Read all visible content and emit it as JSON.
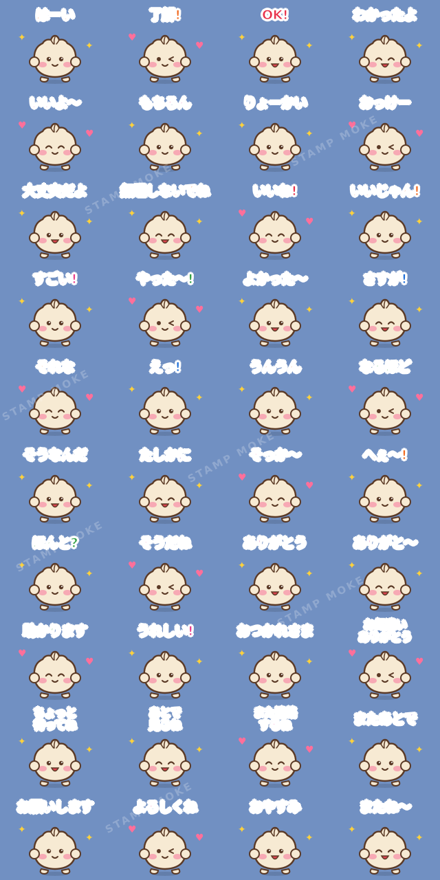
{
  "watermark_text": "STAMP MOKE",
  "colors": {
    "background": "#7190c2",
    "bun": "#f7ead3",
    "outline": "#5b3a26",
    "cheek": "#f7a9b4",
    "orange": "#f26b21",
    "red": "#e8304a",
    "pink": "#e83e8c",
    "blue": "#1f6fd8",
    "green": "#2e9e3f",
    "purple": "#7a3fc6",
    "star": "#ffd23c",
    "heart": "#ff6f9a"
  },
  "stickers": [
    {
      "label": "はーい",
      "color": "#f26b21"
    },
    {
      "label": "了解!",
      "color": "#f26b21"
    },
    {
      "label": "OK!",
      "color": "#e8304a"
    },
    {
      "label": "わかったよ",
      "color": "#2e9e3f"
    },
    {
      "label": "いいよ〜",
      "color": "#e83e8c"
    },
    {
      "label": "もちろん",
      "color": "#e83e8c"
    },
    {
      "label": "りょーかい",
      "color": "#1f6fd8"
    },
    {
      "label": "おっけー",
      "color": "#7a3fc6"
    },
    {
      "label": "大丈夫だよ",
      "color": "#2e9e3f"
    },
    {
      "label": "無理しないでね",
      "color": "#f26b21"
    },
    {
      "label": "いいね!",
      "color": "#e8304a"
    },
    {
      "label": "いいじゃん!",
      "color": "#f26b21"
    },
    {
      "label": "すごい!",
      "color": "#e83e8c"
    },
    {
      "label": "やった〜!",
      "color": "#2e9e3f"
    },
    {
      "label": "よかった〜",
      "color": "#e83e8c"
    },
    {
      "label": "さすが!",
      "color": "#1f6fd8"
    },
    {
      "label": "それな",
      "color": "#f26b21"
    },
    {
      "label": "えっ!",
      "color": "#1f6fd8"
    },
    {
      "label": "うんうん",
      "color": "#f26b21"
    },
    {
      "label": "なるほど",
      "color": "#2e9e3f"
    },
    {
      "label": "そうなんだ",
      "color": "#1f6fd8"
    },
    {
      "label": "たしかに",
      "color": "#7a3fc6"
    },
    {
      "label": "そっか〜",
      "color": "#e83e8c"
    },
    {
      "label": "へぇ〜!",
      "color": "#f26b21"
    },
    {
      "label": "ほんと?",
      "color": "#2e9e3f"
    },
    {
      "label": "そうだね",
      "color": "#e83e8c"
    },
    {
      "label": "ありがとう",
      "color": "#e83e8c"
    },
    {
      "label": "ありがと〜",
      "color": "#e83e8c"
    },
    {
      "label": "助かります",
      "color": "#2e9e3f"
    },
    {
      "label": "うれしい!",
      "color": "#e83e8c"
    },
    {
      "label": "おつかれさま",
      "color": "#1f6fd8"
    },
    {
      "label": "お気遣い\nありがとう",
      "color": "#7a3fc6"
    },
    {
      "label": "ちょっと\n待ってね",
      "color": "#1f6fd8"
    },
    {
      "label": "あとで\n見るね",
      "color": "#1f6fd8"
    },
    {
      "label": "また連絡\nするね",
      "color": "#e83e8c"
    },
    {
      "label": "またあとで",
      "color": "#7a3fc6"
    },
    {
      "label": "お願いします",
      "color": "#1f6fd8"
    },
    {
      "label": "よろしくね",
      "color": "#e83e8c"
    },
    {
      "label": "おやすみ",
      "color": "#7a3fc6"
    },
    {
      "label": "またね〜",
      "color": "#e8304a"
    }
  ]
}
